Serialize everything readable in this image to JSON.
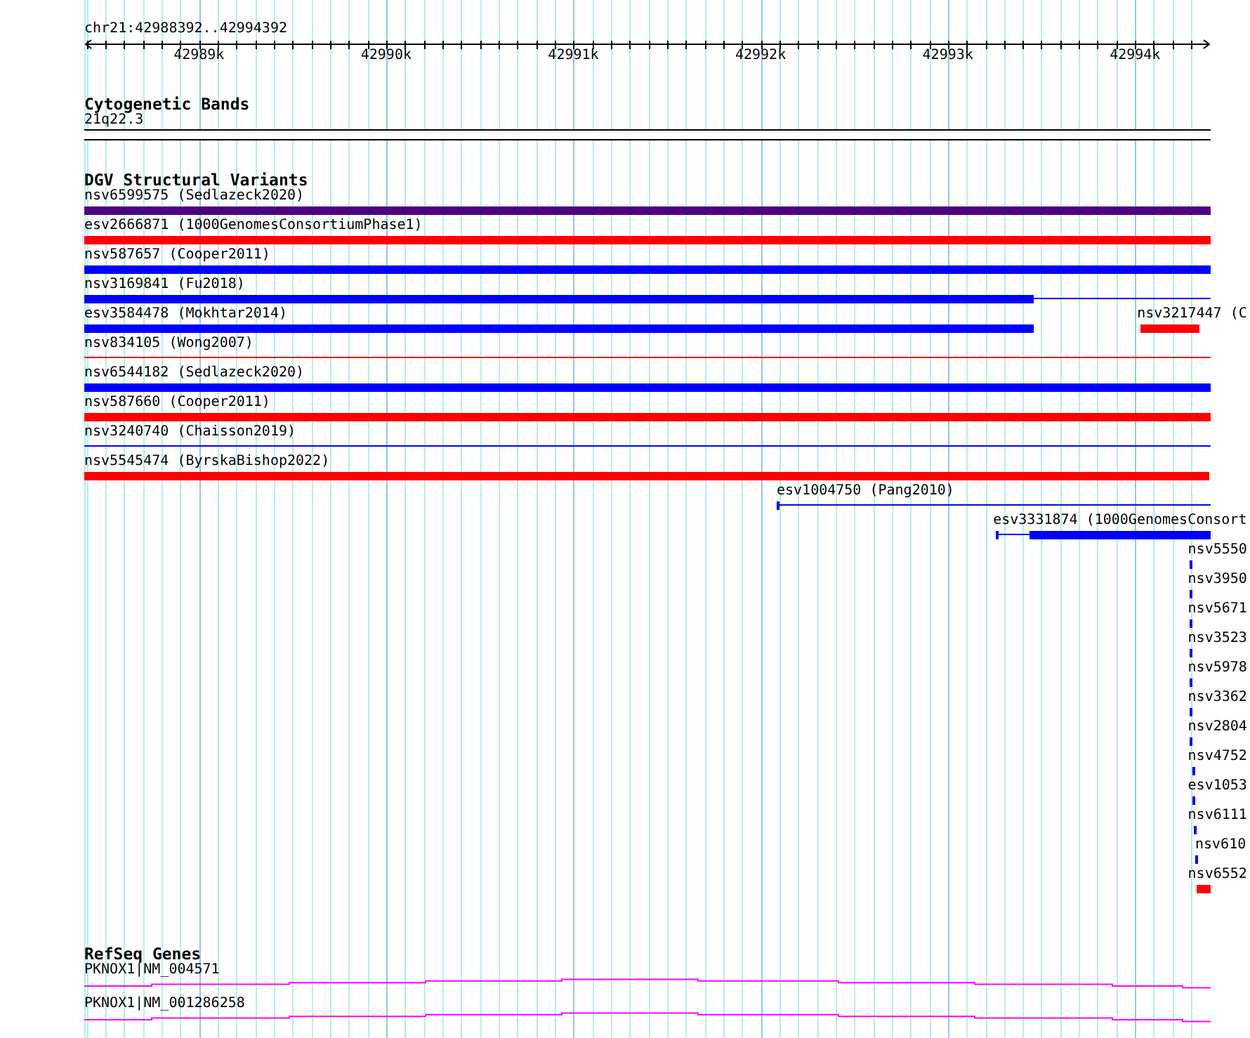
{
  "ruler": {
    "location": "chr21:42988392..42994392",
    "tick_labels": [
      "42989k",
      "42990k",
      "42991k",
      "42992k",
      "42993k",
      "42994k"
    ]
  },
  "tracks": [
    {
      "title": "Cytogenetic Bands",
      "kind": "bands",
      "features": [
        {
          "label": "21q22.3"
        }
      ]
    },
    {
      "title": "DGV Structural Variants",
      "kind": "variants",
      "features": [
        {
          "label": "nsv6599575 (Sedlazeck2020)",
          "color": "#4b0082",
          "kind": "thick"
        },
        {
          "label": "esv2666871 (1000GenomesConsortiumPhase1)",
          "color": "#ff0000",
          "kind": "thick"
        },
        {
          "label": "nsv587657 (Cooper2011)",
          "color": "#0000ff",
          "kind": "thick"
        },
        {
          "label": "nsv3169841 (Fu2018)",
          "color": "#0000ff",
          "kind": "thick_then_thin"
        },
        {
          "label": "esv3584478 (Mokhtar2014)",
          "color": "#0000ff",
          "kind": "thick"
        },
        {
          "label": "nsv3217447 (C",
          "color": "#ff0000",
          "kind": "thick"
        },
        {
          "label": "nsv834105 (Wong2007)",
          "color": "#ff0000",
          "kind": "thin"
        },
        {
          "label": "nsv6544182 (Sedlazeck2020)",
          "color": "#0000ff",
          "kind": "thick"
        },
        {
          "label": "nsv587660 (Cooper2011)",
          "color": "#ff0000",
          "kind": "thick"
        },
        {
          "label": "nsv3240740 (Chaisson2019)",
          "color": "#0000ff",
          "kind": "thin"
        },
        {
          "label": "nsv5545474 (ByrskaBishop2022)",
          "color": "#ff0000",
          "kind": "thick"
        },
        {
          "label": "esv1004750 (Pang2010)",
          "color": "#0000ff",
          "kind": "thin"
        },
        {
          "label": "esv3331874 (1000GenomesConsort",
          "color": "#0000ff",
          "kind": "thin_then_thick"
        },
        {
          "label": "nsv5550",
          "color": "#0000ff",
          "kind": "thick"
        },
        {
          "label": "nsv3950",
          "color": "#0000ff",
          "kind": "thick"
        },
        {
          "label": "nsv5671",
          "color": "#0000ff",
          "kind": "thick"
        },
        {
          "label": "nsv3523",
          "color": "#0000ff",
          "kind": "thick"
        },
        {
          "label": "nsv5978",
          "color": "#0000ff",
          "kind": "thick"
        },
        {
          "label": "nsv3362",
          "color": "#0000ff",
          "kind": "thick"
        },
        {
          "label": "nsv2804",
          "color": "#0000ff",
          "kind": "thick"
        },
        {
          "label": "nsv4752",
          "color": "#0000ff",
          "kind": "thick"
        },
        {
          "label": "esv1053",
          "color": "#0000ff",
          "kind": "thick"
        },
        {
          "label": "nsv6111",
          "color": "#0000ff",
          "kind": "thick"
        },
        {
          "label": "nsv610",
          "color": "#0000ff",
          "kind": "thick"
        },
        {
          "label": "nsv6552",
          "color": "#ff0000",
          "kind": "thick"
        }
      ]
    },
    {
      "title": "RefSeq Genes",
      "kind": "genes",
      "features": [
        {
          "label": "PKNOX1|NM_004571"
        },
        {
          "label": "PKNOX1|NM_001286258"
        }
      ]
    }
  ]
}
